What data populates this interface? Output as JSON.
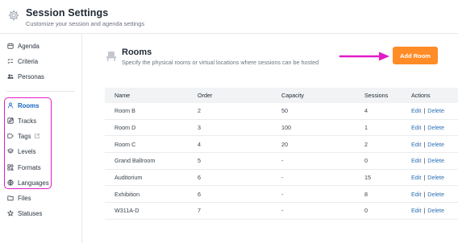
{
  "header": {
    "icon": "gear-icon",
    "title": "Session Settings",
    "subtitle": "Customize your session and agenda settings"
  },
  "sidebar": {
    "items": [
      {
        "label": "Agenda",
        "icon": "calendar-icon"
      },
      {
        "label": "Criteria",
        "icon": "checklist-icon"
      },
      {
        "label": "Personas",
        "icon": "people-icon"
      },
      {
        "label": "Rooms",
        "icon": "person-icon",
        "active": true
      },
      {
        "label": "Tracks",
        "icon": "edit-square-icon"
      },
      {
        "label": "Tags",
        "icon": "tag-icon",
        "external": true
      },
      {
        "label": "Levels",
        "icon": "layers-icon"
      },
      {
        "label": "Formats",
        "icon": "shapes-icon"
      },
      {
        "label": "Languages",
        "icon": "globe-icon"
      },
      {
        "label": "Files",
        "icon": "folder-icon"
      },
      {
        "label": "Statuses",
        "icon": "star-icon"
      }
    ],
    "highlight_color": "#e21cc8",
    "active_color": "#1565c0"
  },
  "main": {
    "title": "Rooms",
    "description": "Specify the physical rooms or virtual locations where sessions can be hosted",
    "add_button": "Add Room",
    "add_button_color": "#ff8c26",
    "arrow_color": "#e21cc8"
  },
  "table": {
    "columns": [
      "Name",
      "Order",
      "Capacity",
      "Sessions",
      "Actions"
    ],
    "rows": [
      {
        "name": "Room B",
        "order": "2",
        "capacity": "50",
        "sessions": "4"
      },
      {
        "name": "Room D",
        "order": "3",
        "capacity": "100",
        "sessions": "1"
      },
      {
        "name": "Room C",
        "order": "4",
        "capacity": "20",
        "sessions": "2"
      },
      {
        "name": "Grand Ballroom",
        "order": "5",
        "capacity": "-",
        "sessions": "0"
      },
      {
        "name": "Auditorium",
        "order": "6",
        "capacity": "-",
        "sessions": "15"
      },
      {
        "name": "Exhibition",
        "order": "6",
        "capacity": "-",
        "sessions": "8"
      },
      {
        "name": "W311A-D",
        "order": "7",
        "capacity": "-",
        "sessions": "0"
      }
    ],
    "actions": {
      "edit": "Edit",
      "separator": "|",
      "delete": "Delete"
    }
  }
}
